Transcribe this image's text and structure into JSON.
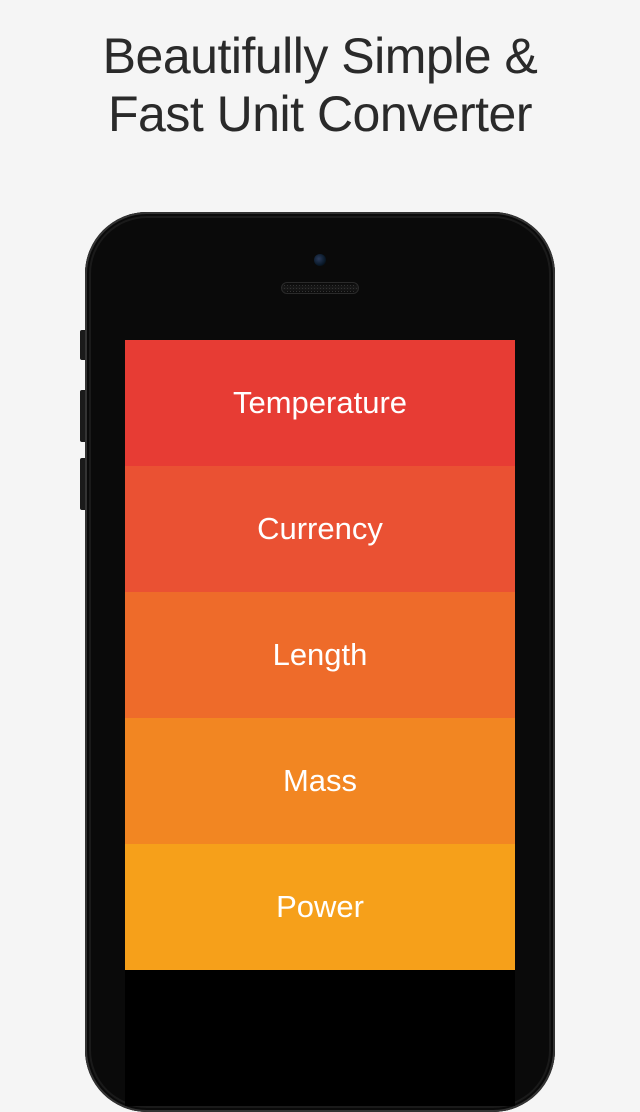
{
  "headline": {
    "line1": "Beautifully Simple &",
    "line2": "Fast Unit Converter"
  },
  "categories": [
    {
      "label": "Temperature"
    },
    {
      "label": "Currency"
    },
    {
      "label": "Length"
    },
    {
      "label": "Mass"
    },
    {
      "label": "Power"
    }
  ]
}
